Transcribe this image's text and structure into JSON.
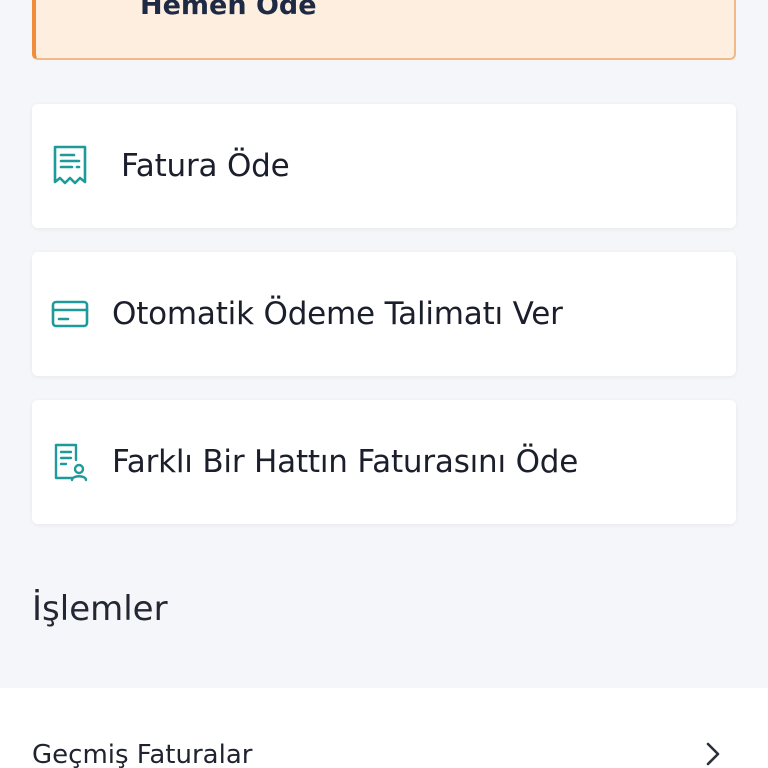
{
  "pay_now": {
    "label": "Hemen Öde"
  },
  "actions": [
    {
      "label": "Fatura Öde",
      "icon": "receipt-icon"
    },
    {
      "label": "Otomatik Ödeme Talimatı Ver",
      "icon": "credit-card-icon"
    },
    {
      "label": "Farklı Bir Hattın Faturasını Öde",
      "icon": "document-user-icon"
    }
  ],
  "section": {
    "title": "İşlemler"
  },
  "list": [
    {
      "label": "Geçmiş Faturalar",
      "icon": "chevron-right-icon"
    }
  ],
  "colors": {
    "accent": "#1f9a9a",
    "warning_bg": "#fdeee0",
    "warning_border": "#f08c3a",
    "page_bg": "#f5f6f9"
  }
}
